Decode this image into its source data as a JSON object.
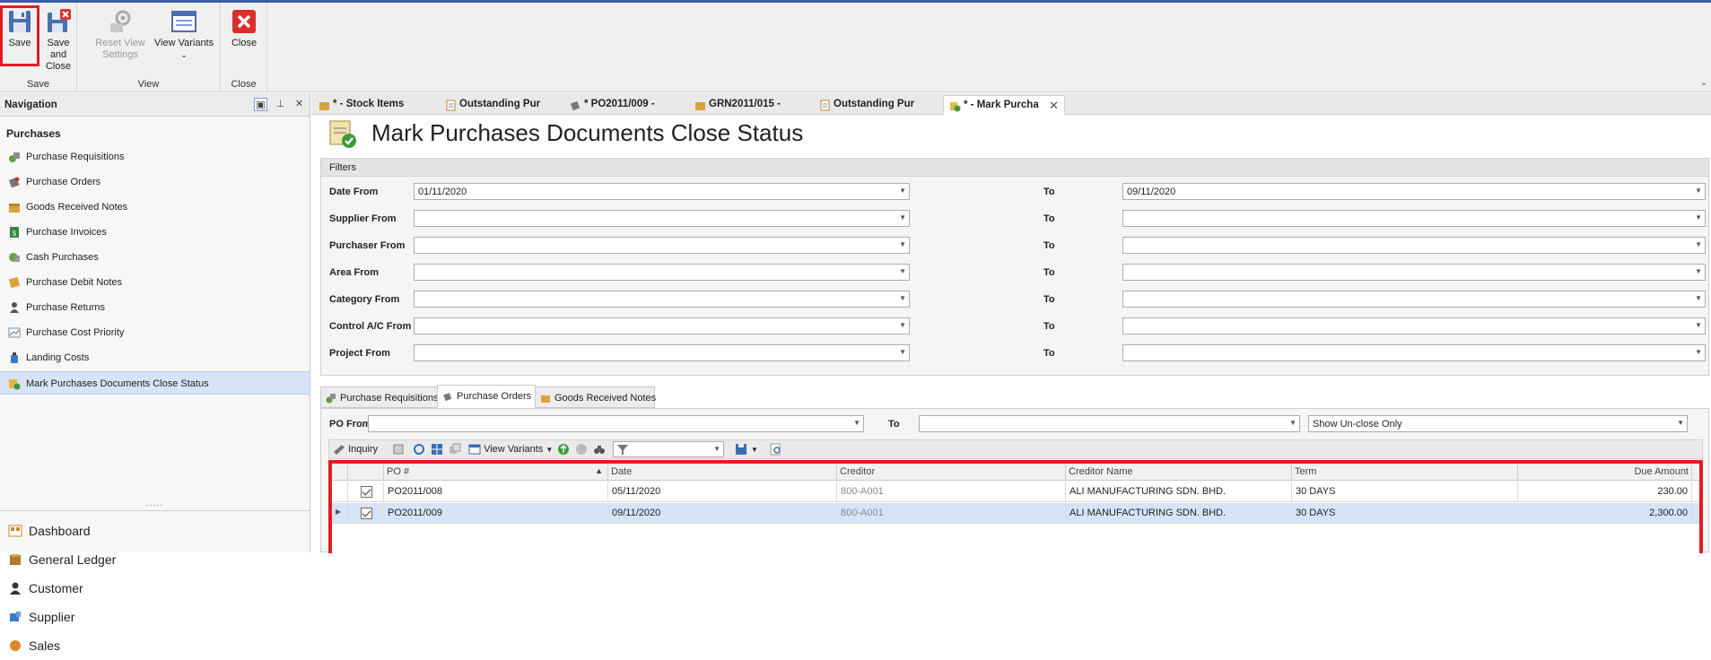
{
  "ribbon": {
    "groups": [
      {
        "title": "Save",
        "buttons": [
          {
            "label": "Save",
            "icon": "floppy-disk-icon"
          },
          {
            "label": "Save and\nClose",
            "icon": "save-close-icon"
          }
        ]
      },
      {
        "title": "View",
        "buttons": [
          {
            "label": "Reset View\nSettings",
            "icon": "reset-gear-icon"
          },
          {
            "label": "View Variants",
            "icon": "view-variants-icon"
          }
        ]
      },
      {
        "title": "Close",
        "buttons": [
          {
            "label": "Close",
            "icon": "close-red-x-icon"
          }
        ]
      }
    ],
    "save": "Save",
    "save_close_1": "Save and",
    "save_close_2": "Close",
    "reset_1": "Reset View",
    "reset_2": "Settings",
    "view_variants": "View Variants",
    "close": "Close",
    "group_save": "Save",
    "group_view": "View",
    "group_close": "Close"
  },
  "navigation": {
    "title": "Navigation",
    "section": "Purchases",
    "items": [
      "Purchase Requisitions",
      "Purchase Orders",
      "Goods Received Notes",
      "Purchase Invoices",
      "Cash Purchases",
      "Purchase Debit Notes",
      "Purchase Returns",
      "Purchase Cost Priority",
      "Landing Costs",
      "Mark Purchases Documents Close Status"
    ],
    "selected": "Mark Purchases Documents Close Status",
    "modules": [
      "Dashboard",
      "General Ledger",
      "Customer",
      "Supplier",
      "Sales"
    ]
  },
  "tabs": [
    {
      "label": "* - Stock Items"
    },
    {
      "label": "Outstanding Pur"
    },
    {
      "label": "* PO2011/009 -"
    },
    {
      "label": "GRN2011/015 -"
    },
    {
      "label": "Outstanding Pur"
    },
    {
      "label": "* - Mark Purcha",
      "active": true
    }
  ],
  "page": {
    "title": "Mark Purchases Documents Close Status"
  },
  "filters": {
    "header": "Filters",
    "to_label": "To",
    "rows": [
      {
        "label": "Date From",
        "from": "01/11/2020",
        "to": "09/11/2020"
      },
      {
        "label": "Supplier From",
        "from": "",
        "to": ""
      },
      {
        "label": "Purchaser From",
        "from": "",
        "to": ""
      },
      {
        "label": "Area From",
        "from": "",
        "to": ""
      },
      {
        "label": "Category From",
        "from": "",
        "to": ""
      },
      {
        "label": "Control A/C From",
        "from": "",
        "to": ""
      },
      {
        "label": "Project From",
        "from": "",
        "to": ""
      }
    ]
  },
  "subtabs": [
    "Purchase Requisitions",
    "Purchase Orders",
    "Goods Received Notes"
  ],
  "po_filter": {
    "label": "PO From",
    "to_label": "To",
    "from": "",
    "to": "",
    "show": "Show Un-close Only"
  },
  "toolbar": {
    "inquiry": "Inquiry",
    "view_variants": "View Variants"
  },
  "grid": {
    "columns": [
      "PO #",
      "Date",
      "Creditor",
      "Creditor Name",
      "Term",
      "Due Amount"
    ],
    "rows": [
      {
        "checked": true,
        "po": "PO2011/008",
        "date": "05/11/2020",
        "creditor": "800-A001",
        "name": "ALI MANUFACTURING SDN. BHD.",
        "term": "30 DAYS",
        "amount": "230.00"
      },
      {
        "checked": true,
        "po": "PO2011/009",
        "date": "09/11/2020",
        "creditor": "800-A001",
        "name": "ALI MANUFACTURING SDN. BHD.",
        "term": "30 DAYS",
        "amount": "2,300.00",
        "selected": true
      }
    ]
  },
  "colors": {
    "highlight": "#e31b23",
    "selection": "#d6e4f5",
    "accent": "#3b5ea6"
  }
}
